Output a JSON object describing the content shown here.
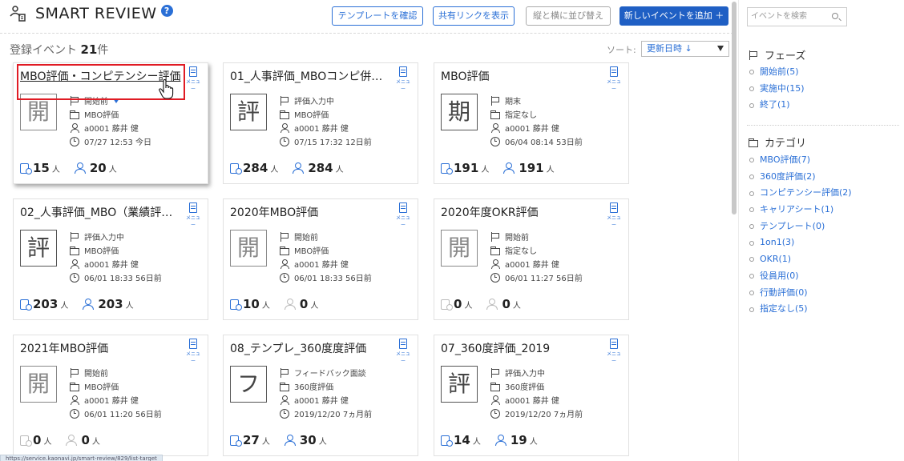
{
  "header": {
    "title": "SMART REVIEW",
    "help": "?",
    "buttons": {
      "template": "テンプレートを確認",
      "share": "共有リンクを表示",
      "sort_layout": "縦と横に並び替え",
      "add_event": "新しいイベントを追加 ＋"
    }
  },
  "summary": {
    "label": "登録イベント",
    "count": "21",
    "unit": "件"
  },
  "sort": {
    "label": "ソート:",
    "value": "更新日時 ↓"
  },
  "menu_label": "メニュー",
  "cards": [
    {
      "title": "MBO評価・コンピテンシー評価",
      "char": "開",
      "phase": "開始前",
      "category": "MBO評価",
      "owner": "a0001 藤井 健",
      "time": "07/27 12:53 今日",
      "reviewers": "15",
      "targets": "20",
      "unit": "人"
    },
    {
      "title": "01_人事評価_MBOコンピ併…",
      "char": "評",
      "phase": "評価入力中",
      "category": "MBO評価",
      "owner": "a0001 藤井 健",
      "time": "07/15 17:32 12日前",
      "reviewers": "284",
      "targets": "284",
      "unit": "人"
    },
    {
      "title": "MBO評価",
      "char": "期",
      "phase": "期末",
      "category": "指定なし",
      "owner": "a0001 藤井 健",
      "time": "06/04 08:14 53日前",
      "reviewers": "191",
      "targets": "191",
      "unit": "人"
    },
    {
      "title": "02_人事評価_MBO（業績評…",
      "char": "評",
      "phase": "評価入力中",
      "category": "MBO評価",
      "owner": "a0001 藤井 健",
      "time": "06/01 18:33 56日前",
      "reviewers": "203",
      "targets": "203",
      "unit": "人"
    },
    {
      "title": "2020年MBO評価",
      "char": "開",
      "phase": "開始前",
      "category": "MBO評価",
      "owner": "a0001 藤井 健",
      "time": "06/01 18:33 56日前",
      "reviewers": "10",
      "targets": "0",
      "unit": "人"
    },
    {
      "title": "2020年度OKR評価",
      "char": "開",
      "phase": "開始前",
      "category": "指定なし",
      "owner": "a0001 藤井 健",
      "time": "06/01 11:27 56日前",
      "reviewers": "0",
      "targets": "0",
      "unit": "人"
    },
    {
      "title": "2021年MBO評価",
      "char": "開",
      "phase": "開始前",
      "category": "MBO評価",
      "owner": "a0001 藤井 健",
      "time": "06/01 11:20 56日前",
      "reviewers": "0",
      "targets": "0",
      "unit": "人"
    },
    {
      "title": "08_テンプレ_360度度評価",
      "char": "フ",
      "phase": "フィードバック面談",
      "category": "360度評価",
      "owner": "a0001 藤井 健",
      "time": "2019/12/20 7ヵ月前",
      "reviewers": "27",
      "targets": "30",
      "unit": "人"
    },
    {
      "title": "07_360度評価_2019",
      "char": "評",
      "phase": "評価入力中",
      "category": "360度評価",
      "owner": "a0001 藤井 健",
      "time": "2019/12/20 7ヵ月前",
      "reviewers": "14",
      "targets": "19",
      "unit": "人"
    }
  ],
  "status_url": "https://service.kaonavi.jp/smart-review/829/list-target",
  "sidebar": {
    "search_placeholder": "イベントを検索",
    "phase_title": "フェーズ",
    "phases": [
      "開始前(5)",
      "実施中(15)",
      "終了(1)"
    ],
    "category_title": "カテゴリ",
    "categories": [
      "MBO評価(7)",
      "360度評価(2)",
      "コンピテンシー評価(2)",
      "キャリアシート(1)",
      "テンプレート(0)",
      "1on1(3)",
      "OKR(1)",
      "役員用(0)",
      "行動評価(0)",
      "指定なし(5)"
    ]
  },
  "colors": {
    "accent": "#2a6fd6",
    "primary_button": "#1f5fc4",
    "highlight": "#e01b24"
  }
}
